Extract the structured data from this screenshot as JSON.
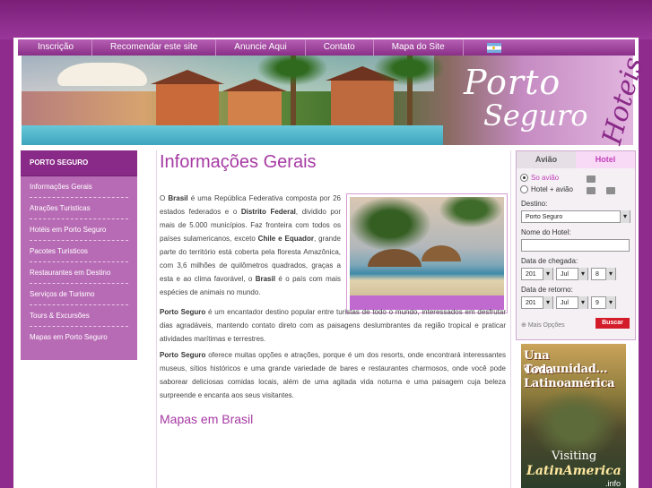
{
  "nav": {
    "items": [
      "Inscrição",
      "Recomendar este site",
      "Anuncie Aqui",
      "Contato",
      "Mapa do Site"
    ],
    "flag_icon": "argentina-flag-icon"
  },
  "logo": {
    "line1": "Porto",
    "line2": "Seguro",
    "line3": "Hoteis"
  },
  "sidebar": {
    "heading": "PORTO SEGURO",
    "items": [
      "Informações Gerais",
      "Atrações Turisticas",
      "Hotéis em Porto Seguro",
      "Pacotes Turisticos",
      "Restaurantes em Destino",
      "Serviços de Turismo",
      "Tours & Excursões",
      "Mapas em Porto Seguro"
    ]
  },
  "main": {
    "title": "Informações Gerais",
    "p1": {
      "a": "O ",
      "b1": "Brasil",
      "c": " é uma República Federativa composta por 26 estados federados e o ",
      "b2": "Distrito Federal",
      "d": ", dividido por mais de 5.000 municípios. Faz fronteira com todos os países sulamericanos, exceto ",
      "b3": "Chile e Equador",
      "e": ", grande parte do território está coberta pela floresta Amazônica, com 3,6 milhões de quilômetros quadrados, graças a esta e ao clima favorável, o ",
      "b4": "Brasil",
      "f": " é o país com mais espécies de animais no mundo."
    },
    "p2": {
      "b1": "Porto Seguro",
      "a": " é um encantador destino popular entre turistas de todo o mundo, interessados em desfrutar dias agradáveis, mantendo contato direto com as paisagens deslumbrantes da região tropical e praticar atividades marítimas e terrestres."
    },
    "p3": {
      "b1": "Porto Seguro",
      "a": " oferece muitas opções e atrações, porque é um dos resorts, onde encontrará interessantes museus, sítios históricos e uma grande variedade de bares e restaurantes charmosos, onde você pode saborear deliciosas comidas locais, além de uma agitada vida noturna e uma paisagem cuja beleza surpreende e encanta aos seus visitantes."
    },
    "subtitle": "Mapas em Brasil"
  },
  "booking": {
    "tab_aviao": "Avião",
    "tab_hotel": "Hotel",
    "opt1": "So avião",
    "opt2": "Hotel + avião",
    "destino_label": "Destino:",
    "destino_value": "Porto Seguro",
    "hotel_label": "Nome do Hotel:",
    "chegada_label": "Data de chegada:",
    "chegada": {
      "year": "201",
      "month": "Jul",
      "day": "8"
    },
    "retorno_label": "Data de retorno:",
    "retorno": {
      "year": "201",
      "month": "Jul",
      "day": "9"
    },
    "more": "Mais Opções",
    "search": "Buscar"
  },
  "ad": {
    "line1": "Una Comunidad...",
    "line2": "Toda Latinoamérica",
    "line3": "Visiting",
    "line4": "LatinAmerica",
    "line5": ".info"
  }
}
